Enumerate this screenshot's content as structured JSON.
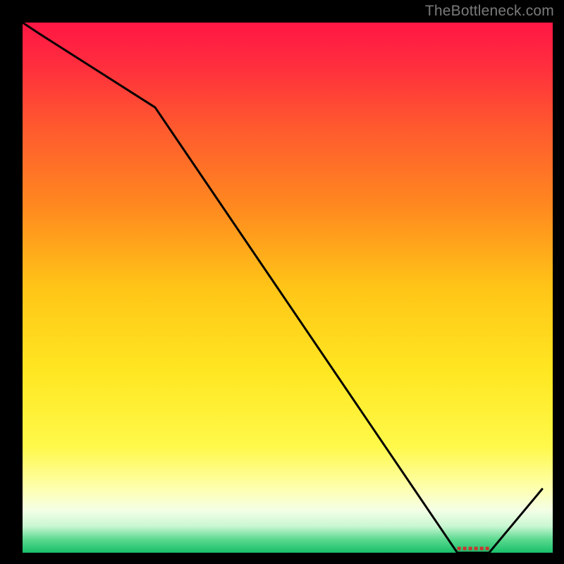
{
  "watermark": "TheBottleneck.com",
  "chart_data": {
    "type": "line",
    "title": "",
    "xlabel": "",
    "ylabel": "",
    "xlim": [
      0,
      100
    ],
    "ylim": [
      0,
      100
    ],
    "x": [
      0,
      3,
      25,
      82,
      88,
      98
    ],
    "values": [
      100,
      98,
      84,
      0,
      0,
      12
    ],
    "flat_region_x": [
      82,
      88
    ],
    "gradient_stops": [
      {
        "offset": 0.0,
        "color": "#ff1744"
      },
      {
        "offset": 0.07,
        "color": "#ff2a3f"
      },
      {
        "offset": 0.2,
        "color": "#ff5a2e"
      },
      {
        "offset": 0.35,
        "color": "#ff8a1f"
      },
      {
        "offset": 0.5,
        "color": "#ffc517"
      },
      {
        "offset": 0.66,
        "color": "#ffe722"
      },
      {
        "offset": 0.8,
        "color": "#fff94a"
      },
      {
        "offset": 0.88,
        "color": "#fdffb0"
      },
      {
        "offset": 0.92,
        "color": "#f4ffe6"
      },
      {
        "offset": 0.95,
        "color": "#c9f7d2"
      },
      {
        "offset": 0.975,
        "color": "#5bd98f"
      },
      {
        "offset": 1.0,
        "color": "#18c06a"
      }
    ],
    "marker_color": "#c8372f",
    "line_color": "#000000"
  }
}
